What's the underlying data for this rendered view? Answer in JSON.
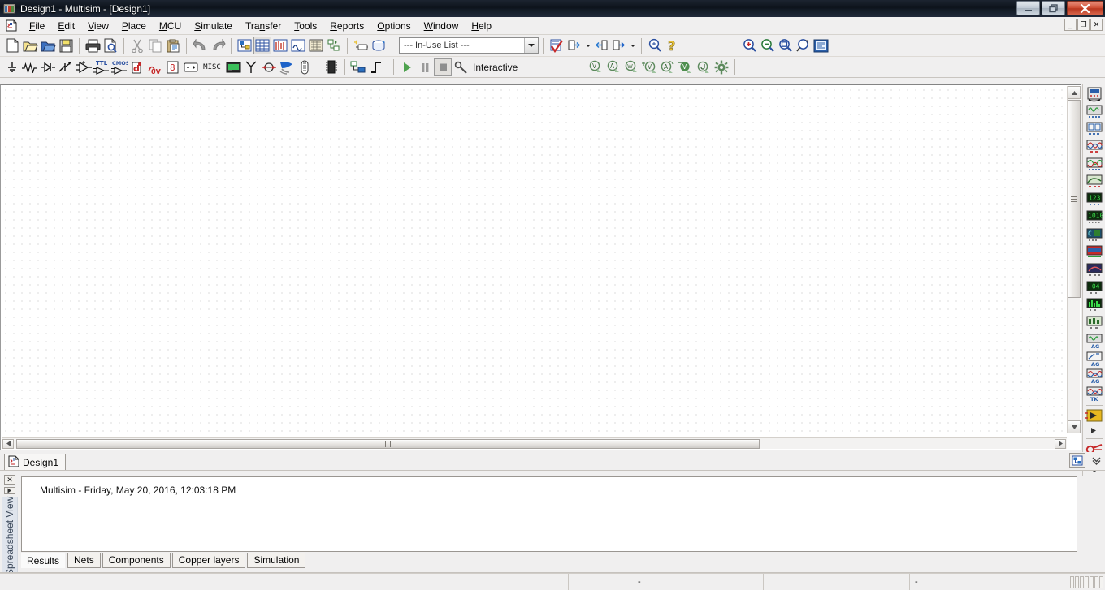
{
  "window": {
    "title": "Design1 - Multisim - [Design1]",
    "app_icon": "multisim-icon",
    "controls": {
      "minimize": "—",
      "maximize": "❐",
      "close": "✕"
    }
  },
  "mdi_controls": {
    "minimize": "_",
    "restore": "❐",
    "close": "✕"
  },
  "menu": {
    "items": [
      {
        "label": "File",
        "accel": "F"
      },
      {
        "label": "Edit",
        "accel": "E"
      },
      {
        "label": "View",
        "accel": "V"
      },
      {
        "label": "Place",
        "accel": "P"
      },
      {
        "label": "MCU",
        "accel": "M"
      },
      {
        "label": "Simulate",
        "accel": "S"
      },
      {
        "label": "Transfer",
        "accel": "n"
      },
      {
        "label": "Tools",
        "accel": "T"
      },
      {
        "label": "Reports",
        "accel": "R"
      },
      {
        "label": "Options",
        "accel": "O"
      },
      {
        "label": "Window",
        "accel": "W"
      },
      {
        "label": "Help",
        "accel": "H"
      }
    ]
  },
  "standard_toolbar": {
    "buttons": [
      {
        "name": "new-file-icon",
        "tooltip": "New"
      },
      {
        "name": "open-file-icon",
        "tooltip": "Open"
      },
      {
        "name": "open-samples-icon",
        "tooltip": "Open samples"
      },
      {
        "name": "save-icon",
        "tooltip": "Save"
      },
      {
        "name": "print-icon",
        "tooltip": "Print"
      },
      {
        "name": "print-preview-icon",
        "tooltip": "Print preview"
      },
      {
        "name": "cut-icon",
        "tooltip": "Cut"
      },
      {
        "name": "copy-icon",
        "tooltip": "Copy"
      },
      {
        "name": "paste-icon",
        "tooltip": "Paste"
      },
      {
        "name": "undo-icon",
        "tooltip": "Undo"
      },
      {
        "name": "redo-icon",
        "tooltip": "Redo"
      },
      {
        "name": "design-toolbox-icon",
        "tooltip": "Toggle design toolbox"
      },
      {
        "name": "spreadsheet-view-icon",
        "tooltip": "Toggle spreadsheet view"
      },
      {
        "name": "spice-netlist-icon",
        "tooltip": "SPICE netlist viewer"
      },
      {
        "name": "grapher-icon",
        "tooltip": "Grapher"
      },
      {
        "name": "postprocessor-icon",
        "tooltip": "Postprocessor"
      },
      {
        "name": "hierarchy-icon",
        "tooltip": "Parent sheet"
      },
      {
        "name": "new-component-icon",
        "tooltip": "Create component"
      },
      {
        "name": "database-manager-icon",
        "tooltip": "Database manager"
      },
      {
        "name": "erc-icon",
        "tooltip": "Electrical rules check"
      },
      {
        "name": "export-layout-icon",
        "tooltip": "Transfer to Ultiboard"
      },
      {
        "name": "import-back-icon",
        "tooltip": "Back annotate from Ultiboard"
      },
      {
        "name": "forward-annotate-icon",
        "tooltip": "Forward annotate"
      },
      {
        "name": "in-use-list-search-icon",
        "tooltip": "Find"
      },
      {
        "name": "help-icon",
        "tooltip": "Help"
      },
      {
        "name": "zoom-in-icon",
        "tooltip": "Zoom in"
      },
      {
        "name": "zoom-out-icon",
        "tooltip": "Zoom out"
      },
      {
        "name": "zoom-area-icon",
        "tooltip": "Zoom area"
      },
      {
        "name": "zoom-fit-icon",
        "tooltip": "Zoom to fit"
      },
      {
        "name": "zoom-sheet-icon",
        "tooltip": "Zoom full screen"
      }
    ]
  },
  "in_use_list": {
    "label": "--- In-Use List ---",
    "selected": "--- In-Use List ---",
    "options": [
      "--- In-Use List ---"
    ]
  },
  "components_toolbar": {
    "buttons": [
      {
        "name": "source-icon",
        "tooltip": "Place source"
      },
      {
        "name": "basic-icon",
        "tooltip": "Place basic"
      },
      {
        "name": "diode-icon",
        "tooltip": "Place diode"
      },
      {
        "name": "transistor-icon",
        "tooltip": "Place transistor"
      },
      {
        "name": "analog-icon",
        "tooltip": "Place analog"
      },
      {
        "name": "ttl-icon",
        "tooltip": "Place TTL"
      },
      {
        "name": "cmos-icon",
        "tooltip": "Place CMOS"
      },
      {
        "name": "misc-digital-icon",
        "tooltip": "Place misc digital"
      },
      {
        "name": "mixed-icon",
        "tooltip": "Place mixed"
      },
      {
        "name": "indicator-icon",
        "tooltip": "Place indicator"
      },
      {
        "name": "power-icon",
        "tooltip": "Place power component"
      },
      {
        "name": "misc-icon",
        "tooltip": "Place misc"
      },
      {
        "name": "advanced-peripherals-icon",
        "tooltip": "Place advanced peripherals"
      },
      {
        "name": "rf-icon",
        "tooltip": "Place RF"
      },
      {
        "name": "electromechanical-icon",
        "tooltip": "Place electro-mechanical"
      },
      {
        "name": "ni-components-icon",
        "tooltip": "Place NI components"
      },
      {
        "name": "connectors-icon",
        "tooltip": "Place connectors"
      },
      {
        "name": "mcu-icon",
        "tooltip": "Place MCU"
      },
      {
        "name": "hierarchical-block-icon",
        "tooltip": "Place hierarchical block"
      },
      {
        "name": "bus-icon",
        "tooltip": "Place bus"
      }
    ],
    "label_misc": "MISC"
  },
  "simulation_toolbar": {
    "run_label": "Run",
    "pause_label": "Pause",
    "stop_label": "Stop",
    "interactive_label": "Interactive",
    "analysis_buttons": [
      {
        "name": "dc-operating-point-icon",
        "glyph": "V"
      },
      {
        "name": "ac-analysis-icon",
        "glyph": "A"
      },
      {
        "name": "transient-analysis-icon",
        "glyph": "W"
      },
      {
        "name": "dc-sweep-icon",
        "glyph": "V"
      },
      {
        "name": "ac-sweep-icon",
        "glyph": "A"
      },
      {
        "name": "single-freq-ac-icon",
        "glyph": "V"
      },
      {
        "name": "probe-settings-icon",
        "glyph": "J"
      },
      {
        "name": "simulation-settings-icon",
        "glyph": "gear"
      }
    ]
  },
  "instruments_panel": {
    "items": [
      {
        "name": "multimeter-icon"
      },
      {
        "name": "function-generator-icon"
      },
      {
        "name": "wattmeter-icon"
      },
      {
        "name": "oscilloscope-icon"
      },
      {
        "name": "four-channel-oscilloscope-icon"
      },
      {
        "name": "bode-plotter-icon"
      },
      {
        "name": "frequency-counter-icon"
      },
      {
        "name": "word-generator-icon"
      },
      {
        "name": "logic-converter-icon"
      },
      {
        "name": "logic-analyzer-icon"
      },
      {
        "name": "iv-analyzer-icon"
      },
      {
        "name": "distortion-analyzer-icon"
      },
      {
        "name": "spectrum-analyzer-icon"
      },
      {
        "name": "network-analyzer-icon"
      },
      {
        "name": "agilent-function-generator-icon"
      },
      {
        "name": "agilent-multimeter-icon"
      },
      {
        "name": "agilent-oscilloscope-icon"
      },
      {
        "name": "tektronix-oscilloscope-icon"
      },
      {
        "name": "labview-instruments-icon"
      },
      {
        "name": "current-probe-icon"
      },
      {
        "name": "measurement-probe-icon"
      },
      {
        "name": "more-instruments-icon"
      }
    ]
  },
  "design_tabs": {
    "tabs": [
      {
        "label": "Design1",
        "icon": "schematic-sheet-icon",
        "active": true
      }
    ],
    "right_buttons": [
      {
        "name": "design-toolbox-toggle-icon"
      },
      {
        "name": "scroll-tabs-down-icon"
      }
    ]
  },
  "spreadsheet": {
    "vertical_title": "Spreadsheet View",
    "close_label": "✕",
    "pin_label": "▸",
    "message": "Multisim  -  Friday, May 20, 2016, 12:03:18 PM",
    "tabs": [
      {
        "label": "Results",
        "active": true
      },
      {
        "label": "Nets",
        "active": false
      },
      {
        "label": "Components",
        "active": false
      },
      {
        "label": "Copper layers",
        "active": false
      },
      {
        "label": "Simulation",
        "active": false
      }
    ]
  },
  "statusbar": {
    "cells": [
      "",
      "-",
      "",
      "-"
    ],
    "resize_grip": "resize-grip"
  },
  "colors": {
    "window_bg": "#f0efef",
    "canvas_bg": "#ffffff",
    "grid_dot": "#b9b9b9",
    "titlebar_dark": "#0d131b",
    "close_red": "#b93720",
    "accent_blue": "#2a5faa",
    "run_green": "#4ea24e",
    "spreadsheet_tab_bg": "#dfe4ec"
  }
}
